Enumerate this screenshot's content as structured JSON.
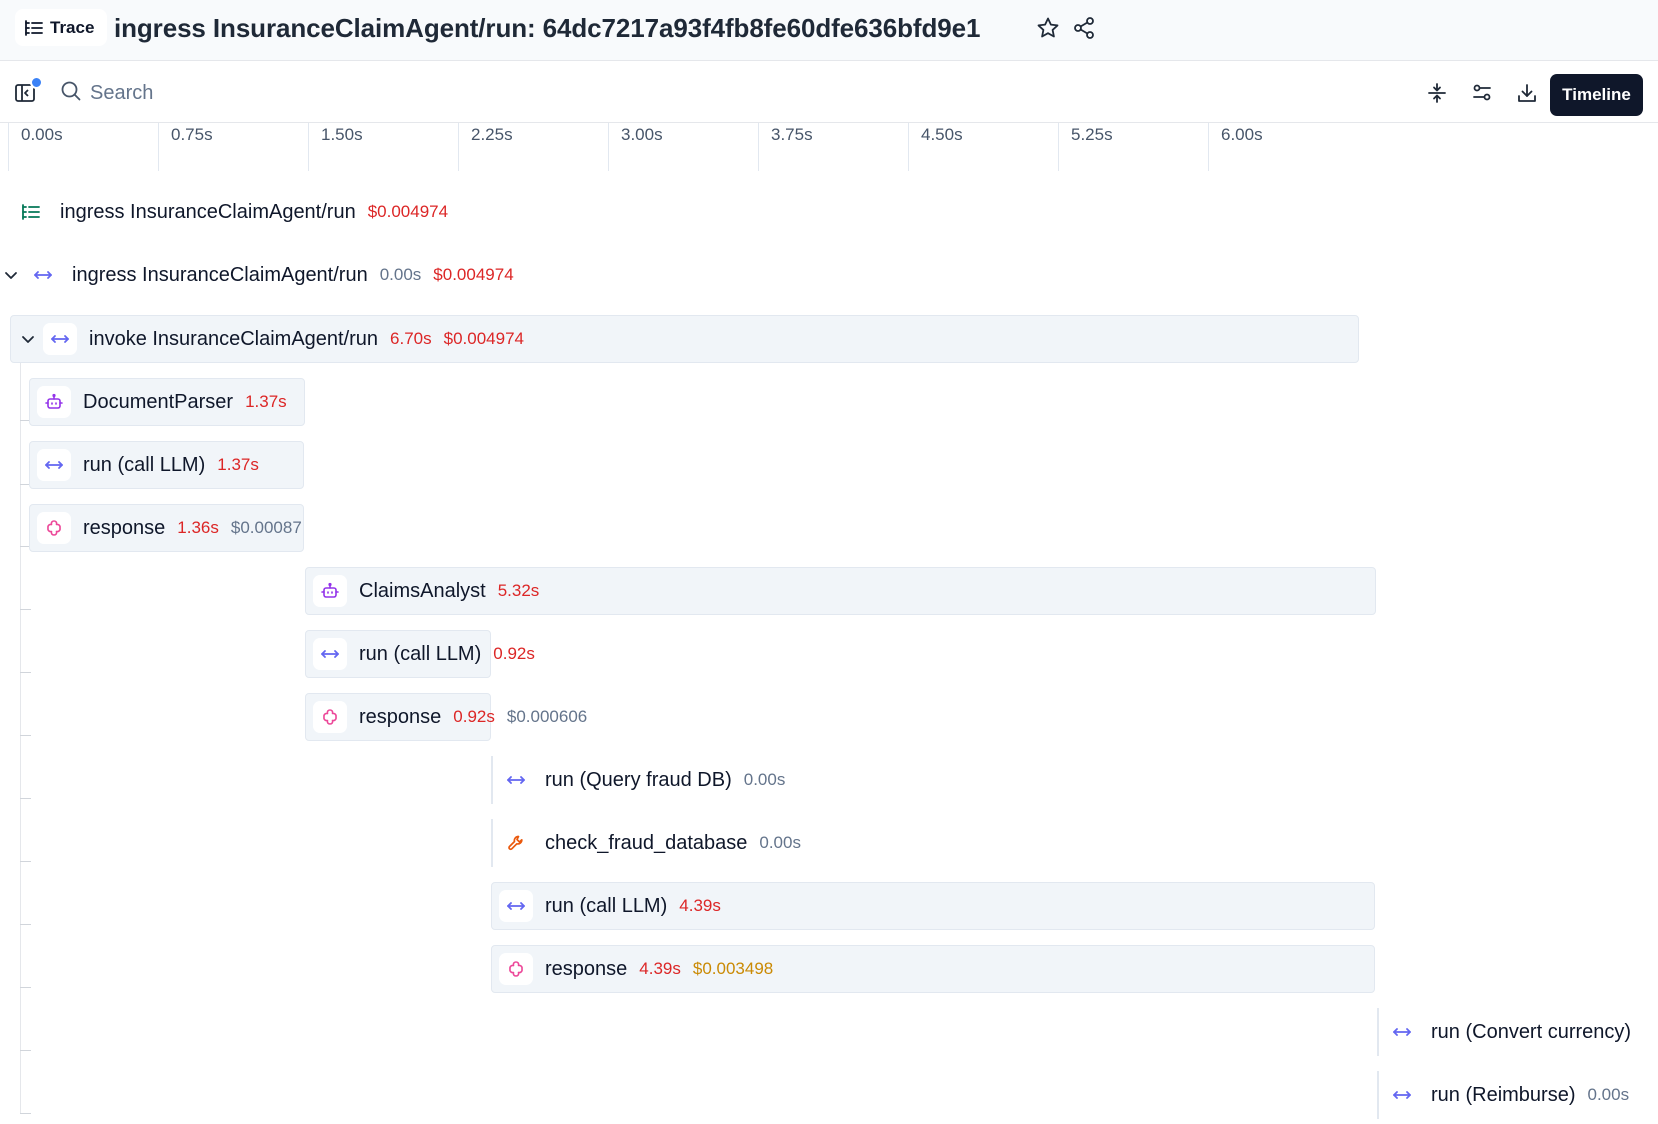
{
  "header": {
    "badge_label": "Trace",
    "title": "ingress InsuranceClaimAgent/run: 64dc7217a93f4fb8fe60dfe636bfd9e1"
  },
  "toolbar": {
    "search_placeholder": "Search",
    "timeline_label": "Timeline"
  },
  "ruler": {
    "ticks": [
      "0.00s",
      "0.75s",
      "1.50s",
      "2.25s",
      "3.00s",
      "3.75s",
      "4.50s",
      "5.25s",
      "6.00s"
    ]
  },
  "spans": [
    {
      "name": "ingress InsuranceClaimAgent/run",
      "duration": "",
      "cost": "$0.004974",
      "icon": "trace-list-icon"
    },
    {
      "name": "ingress InsuranceClaimAgent/run",
      "duration": "0.00s",
      "cost": "$0.004974",
      "icon": "span-arrows-icon"
    },
    {
      "name": "invoke InsuranceClaimAgent/run",
      "duration": "6.70s",
      "cost": "$0.004974",
      "icon": "span-arrows-icon"
    },
    {
      "name": "DocumentParser",
      "duration": "1.37s",
      "cost": "",
      "icon": "agent-bot-icon"
    },
    {
      "name": "run (call LLM)",
      "duration": "1.37s",
      "cost": "",
      "icon": "span-arrows-icon"
    },
    {
      "name": "response",
      "duration": "1.36s",
      "cost": "$0.00087",
      "icon": "llm-response-icon"
    },
    {
      "name": "ClaimsAnalyst",
      "duration": "5.32s",
      "cost": "",
      "icon": "agent-bot-icon"
    },
    {
      "name": "run (call LLM)",
      "duration": "0.92s",
      "cost": "",
      "icon": "span-arrows-icon"
    },
    {
      "name": "response",
      "duration": "0.92s",
      "cost": "$0.000606",
      "icon": "llm-response-icon"
    },
    {
      "name": "run (Query fraud DB)",
      "duration": "0.00s",
      "cost": "",
      "icon": "span-arrows-icon"
    },
    {
      "name": "check_fraud_database",
      "duration": "0.00s",
      "cost": "",
      "icon": "tool-wrench-icon"
    },
    {
      "name": "run (call LLM)",
      "duration": "4.39s",
      "cost": "",
      "icon": "span-arrows-icon"
    },
    {
      "name": "response",
      "duration": "4.39s",
      "cost": "$0.003498",
      "icon": "llm-response-icon"
    },
    {
      "name": "run (Convert currency)",
      "duration": "",
      "cost": "",
      "icon": "span-arrows-icon"
    },
    {
      "name": "run (Reimburse)",
      "duration": "0.00s",
      "cost": "",
      "icon": "span-arrows-icon"
    }
  ],
  "colors": {
    "accent_dark": "#0f172a",
    "duration_red": "#dc2626",
    "cost_gold": "#ca8a04",
    "span_icon": "#6366f1",
    "agent_icon": "#9333ea",
    "response_icon": "#ec4899",
    "tool_icon": "#ea580c",
    "notification_dot": "#3b82f6"
  }
}
